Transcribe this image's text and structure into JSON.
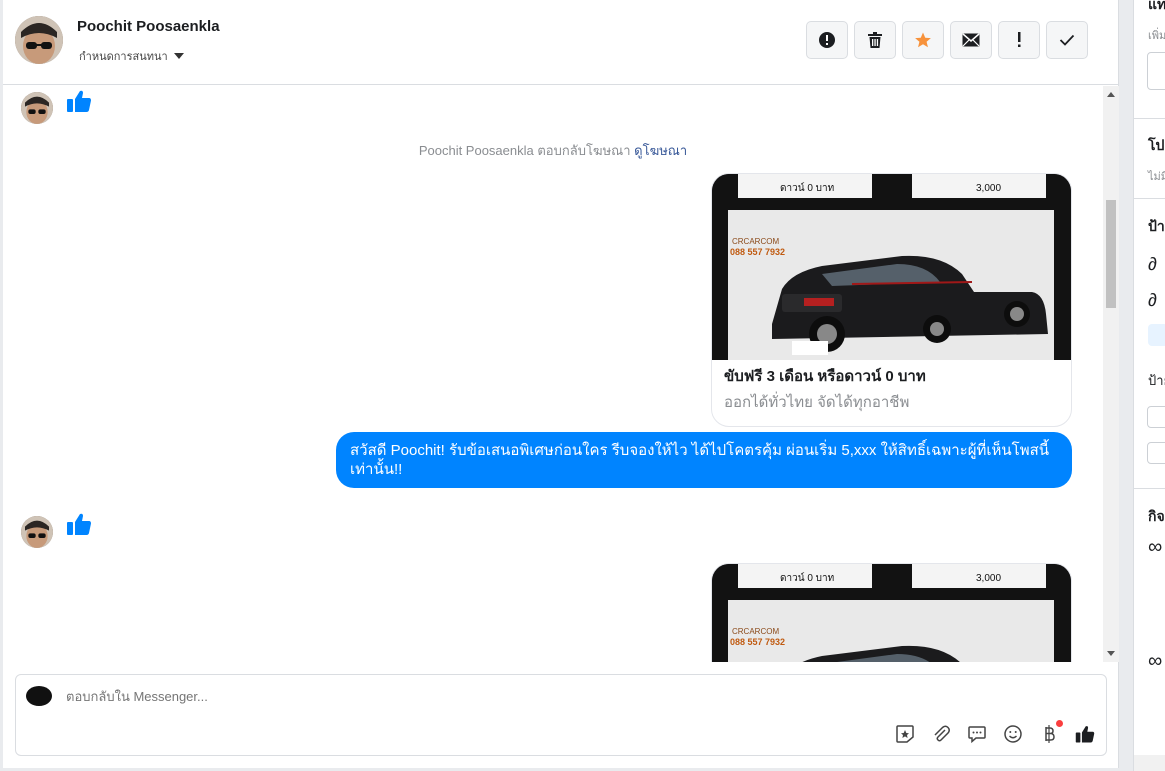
{
  "header": {
    "contact_name": "Poochit Poosaenkla",
    "assign_label": "กำหนดการสนทนา",
    "actions": [
      {
        "icon": "alert-circle-icon",
        "name": "spam-button"
      },
      {
        "icon": "trash-icon",
        "name": "delete-button"
      },
      {
        "icon": "star-icon",
        "name": "star-button"
      },
      {
        "icon": "envelope-icon",
        "name": "mark-unread-button"
      },
      {
        "icon": "exclamation-icon",
        "name": "follow-up-button"
      },
      {
        "icon": "check-icon",
        "name": "mark-done-button"
      }
    ]
  },
  "conversation": {
    "reply_notice": "Poochit Poosaenkla ตอบกลับโฆษณา",
    "reply_notice_link": "ดูโฆษณา",
    "ad": {
      "image_tag_left": "ดาวน์ 0 บาท",
      "image_tag_right": "3,000",
      "image_phone": "088 557 7932",
      "image_brand": "CRCARCOM",
      "title": "ขับฟรี 3 เดือน หรือดาวน์ 0 บาท",
      "subtitle": "ออกได้ทั่วไทย จัดได้ทุกอาชีพ"
    },
    "outgoing_message": "สวัสดี Poochit! รับข้อเสนอพิเศษก่อนใคร รีบจองให้ไว ได้ไปโคตรคุ้ม ผ่อนเริ่ม 5,xxx  ให้สิทธิ์เฉพาะผู้ที่เห็นโพสนี้เท่านั้น!!"
  },
  "composer": {
    "placeholder": "ตอบกลับใน Messenger...",
    "tools": [
      "sticker-icon",
      "attachment-icon",
      "saved-reply-icon",
      "emoji-icon",
      "payment-icon",
      "like-icon"
    ]
  },
  "sidebar": {
    "line1": "แท",
    "line2": "เพิ่ม",
    "line3": "โป",
    "line4": "ไม่มี",
    "line5": "ป้า",
    "line6": "ป้าย",
    "line7": "กิจ"
  },
  "colors": {
    "accent": "#0084ff",
    "star": "#f7923b",
    "text": "#1c1e21",
    "muted": "#8a8d91"
  }
}
